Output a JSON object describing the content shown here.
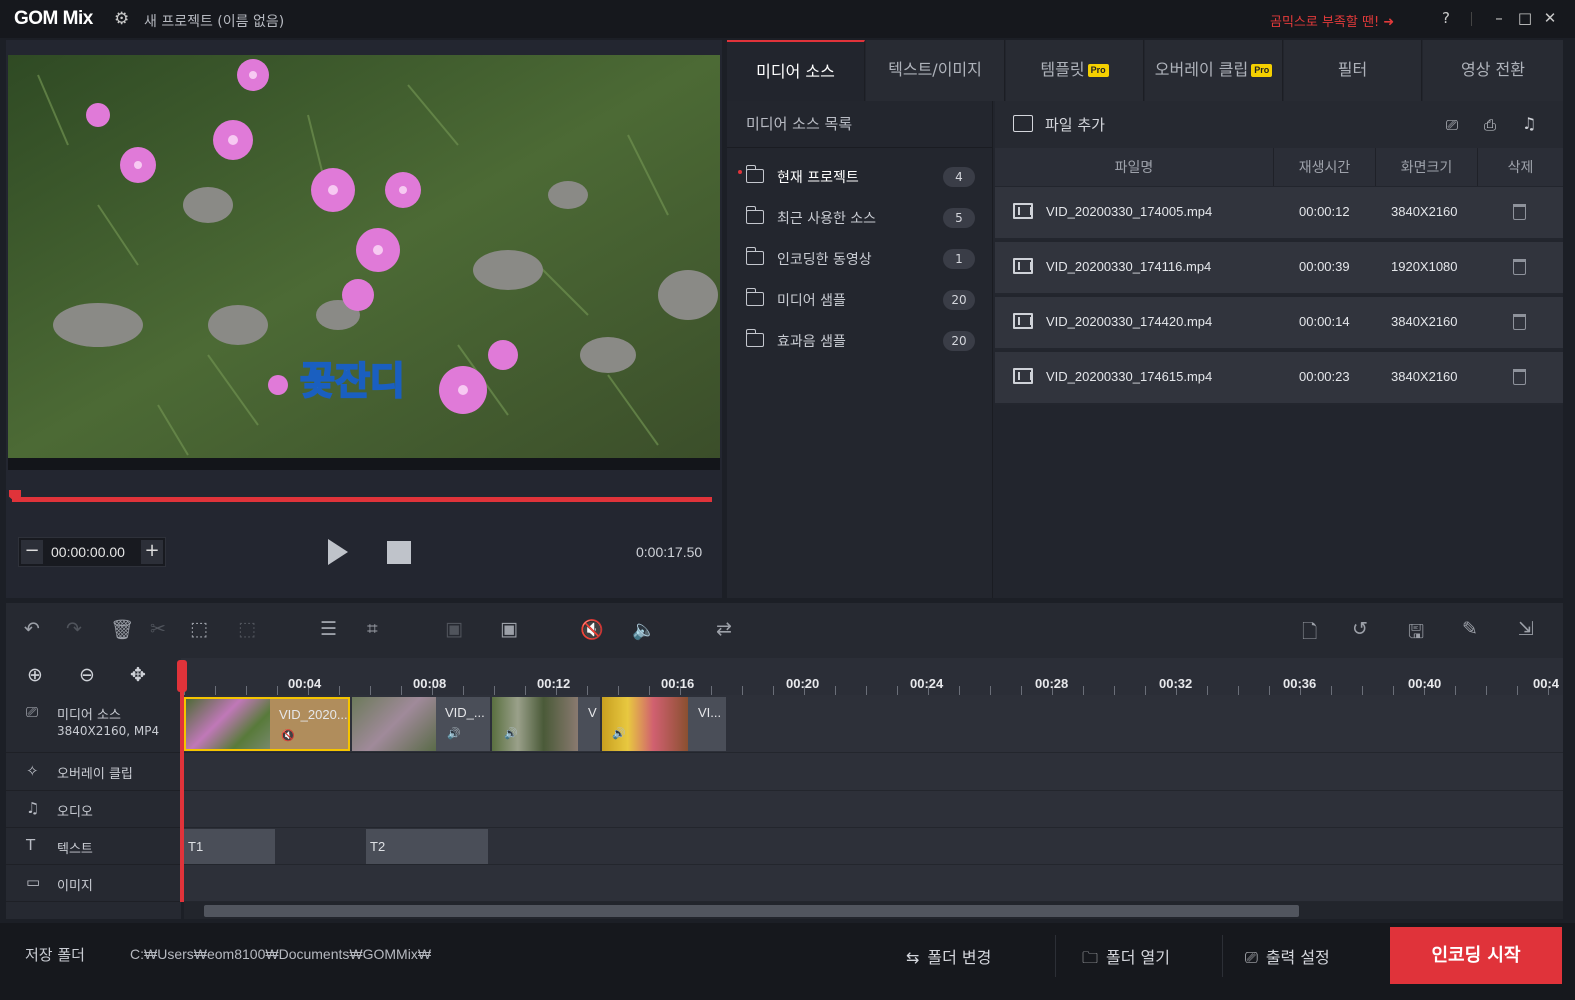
{
  "app": {
    "logo": "GOM Mix",
    "project_title": "새 프로젝트 (이름 없음)",
    "promo_text": "곰믹스로 부족할 땐! ➜",
    "help": "?",
    "accent_color": "#e0333a"
  },
  "preview": {
    "subtitle": "꽃잔디",
    "current_time": "00:00:00.00",
    "minus": "−",
    "plus": "+",
    "total_time": "0:00:17.50",
    "progress": 0
  },
  "tabs": [
    {
      "label": "미디어 소스",
      "active": true
    },
    {
      "label": "텍스트/이미지",
      "active": false
    },
    {
      "label": "템플릿",
      "pro": "Pro",
      "active": false
    },
    {
      "label": "오버레이 클립",
      "pro": "Pro",
      "active": false
    },
    {
      "label": "필터",
      "active": false
    },
    {
      "label": "영상 전환",
      "active": false
    }
  ],
  "source_list": {
    "header": "미디어 소스 목록",
    "items": [
      {
        "label": "현재 프로젝트",
        "count": "4"
      },
      {
        "label": "최근 사용한 소스",
        "count": "5"
      },
      {
        "label": "인코딩한 동영상",
        "count": "1"
      },
      {
        "label": "미디어 샘플",
        "count": "20"
      },
      {
        "label": "효과음 샘플",
        "count": "20"
      }
    ]
  },
  "files": {
    "add_label": "파일 추가",
    "columns": [
      "파일명",
      "재생시간",
      "화면크기",
      "삭제"
    ],
    "rows": [
      {
        "name": "VID_20200330_174005.mp4",
        "duration": "00:00:12",
        "size": "3840X2160"
      },
      {
        "name": "VID_20200330_174116.mp4",
        "duration": "00:00:39",
        "size": "1920X1080"
      },
      {
        "name": "VID_20200330_174420.mp4",
        "duration": "00:00:14",
        "size": "3840X2160"
      },
      {
        "name": "VID_20200330_174615.mp4",
        "duration": "00:00:23",
        "size": "3840X2160"
      }
    ]
  },
  "ruler": {
    "ticks": [
      "00:04",
      "00:08",
      "00:12",
      "00:16",
      "00:20",
      "00:24",
      "00:28",
      "00:32",
      "00:36",
      "00:40",
      "00:4"
    ]
  },
  "tracks": {
    "media": {
      "label": "미디어 소스",
      "info": "3840X2160, MP4"
    },
    "overlay": {
      "label": "오버레이 클립"
    },
    "audio": {
      "label": "오디오"
    },
    "text": {
      "label": "텍스트"
    },
    "image": {
      "label": "이미지"
    }
  },
  "clips": [
    {
      "name": "VID_2020..."
    },
    {
      "name": "VID_..."
    },
    {
      "name": "V"
    },
    {
      "name": "VI..."
    }
  ],
  "text_clips": [
    {
      "name": "T1"
    },
    {
      "name": "T2"
    }
  ],
  "footer": {
    "save_folder_label": "저장 폴더",
    "save_path": "C:₩Users₩eom8100₩Documents₩GOMMix₩",
    "change_folder": "폴더 변경",
    "open_folder": "폴더 열기",
    "output_settings": "출력 설정",
    "encode_start": "인코딩 시작"
  }
}
